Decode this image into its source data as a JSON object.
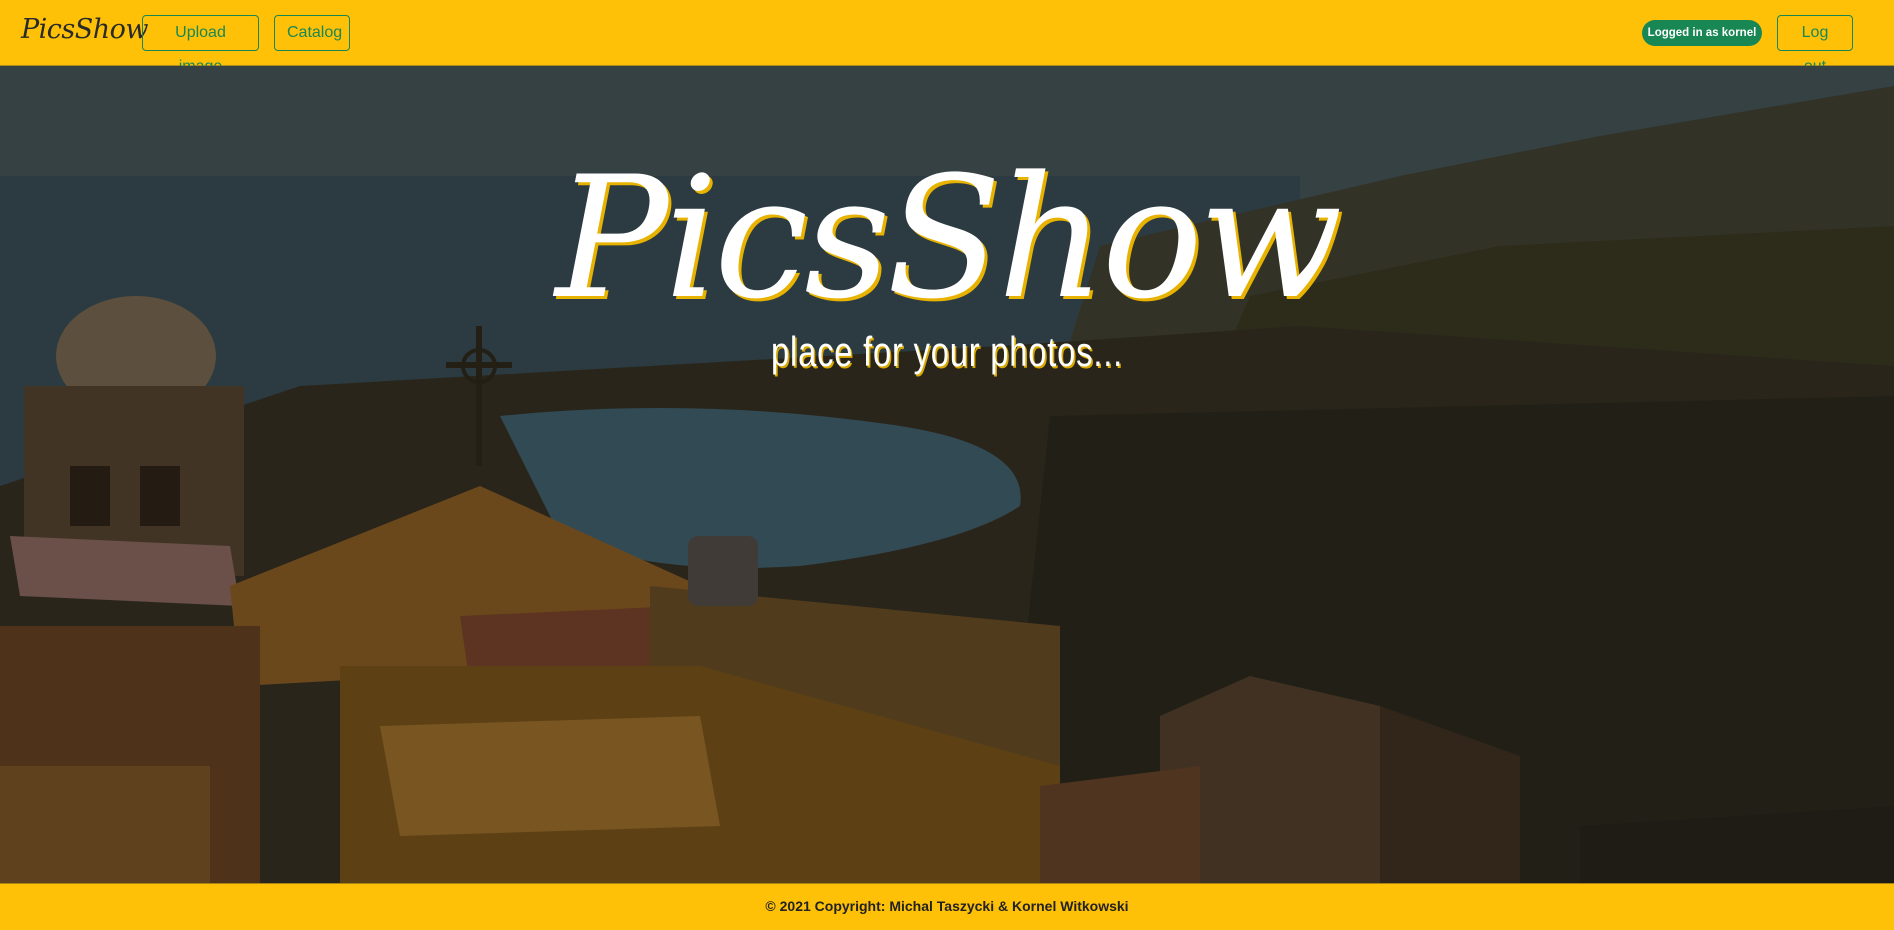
{
  "navbar": {
    "brand": "PicsShow",
    "upload_label": "Upload image",
    "catalog_label": "Catalog",
    "user_badge": "Logged in as kornel",
    "logout_label": "Log out"
  },
  "hero": {
    "title": "PicsShow",
    "subtitle": "place for your photos..."
  },
  "footer": {
    "copyright": "© 2021 Copyright: Michal Taszycki & Kornel Witkowski"
  },
  "colors": {
    "primary_bar": "#ffc107",
    "accent_green": "#198754",
    "text_white": "#ffffff"
  },
  "icons": {
    "background": "coastal-town-photo"
  }
}
